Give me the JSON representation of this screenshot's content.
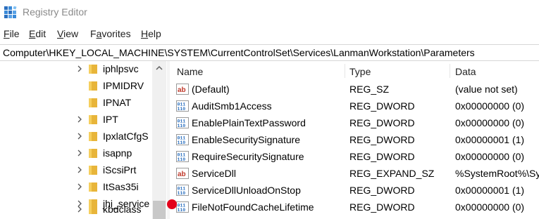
{
  "window": {
    "title": "Registry Editor"
  },
  "menu": [
    {
      "key": "F",
      "rest": "ile"
    },
    {
      "key": "E",
      "rest": "dit"
    },
    {
      "key": "V",
      "rest": "iew"
    },
    {
      "key": "",
      "rest": "F",
      "u": "a",
      "tail": "vorites"
    },
    {
      "key": "H",
      "rest": "elp"
    }
  ],
  "address": {
    "path": "Computer\\HKEY_LOCAL_MACHINE\\SYSTEM\\CurrentControlSet\\Services\\LanmanWorkstation\\Parameters"
  },
  "tree": {
    "items": [
      {
        "label": "iphlpsvc",
        "expandable": true
      },
      {
        "label": "IPMIDRV",
        "expandable": false
      },
      {
        "label": "IPNAT",
        "expandable": false
      },
      {
        "label": "IPT",
        "expandable": true
      },
      {
        "label": "IpxlatCfgS",
        "expandable": true
      },
      {
        "label": "isapnp",
        "expandable": true
      },
      {
        "label": "iScsiPrt",
        "expandable": true
      },
      {
        "label": "ItSas35i",
        "expandable": true
      },
      {
        "label": "jhi_service",
        "expandable": true
      },
      {
        "label": "kbdclass",
        "expandable": true
      }
    ]
  },
  "list": {
    "columns": {
      "name": "Name",
      "type": "Type",
      "data": "Data"
    },
    "rows": [
      {
        "name": "(Default)",
        "type": "REG_SZ",
        "data": "(value not set)",
        "icon": "string-value-icon"
      },
      {
        "name": "AuditSmb1Access",
        "type": "REG_DWORD",
        "data": "0x00000000 (0)",
        "icon": "binary-value-icon"
      },
      {
        "name": "EnablePlainTextPassword",
        "type": "REG_DWORD",
        "data": "0x00000000 (0)",
        "icon": "binary-value-icon"
      },
      {
        "name": "EnableSecuritySignature",
        "type": "REG_DWORD",
        "data": "0x00000001 (1)",
        "icon": "binary-value-icon"
      },
      {
        "name": "RequireSecuritySignature",
        "type": "REG_DWORD",
        "data": "0x00000000 (0)",
        "icon": "binary-value-icon"
      },
      {
        "name": "ServiceDll",
        "type": "REG_EXPAND_SZ",
        "data": "%SystemRoot%\\Sy",
        "icon": "string-value-icon"
      },
      {
        "name": "ServiceDllUnloadOnStop",
        "type": "REG_DWORD",
        "data": "0x00000001 (1)",
        "icon": "binary-value-icon"
      },
      {
        "name": "FileNotFoundCacheLifetime",
        "type": "REG_DWORD",
        "data": "0x00000000 (0)",
        "icon": "binary-value-icon"
      }
    ]
  },
  "colors": {
    "folder": "#e8b53a",
    "string_icon": "#c0392b",
    "binary_icon": "#2a6fbf",
    "cursor": "#e3001b"
  }
}
